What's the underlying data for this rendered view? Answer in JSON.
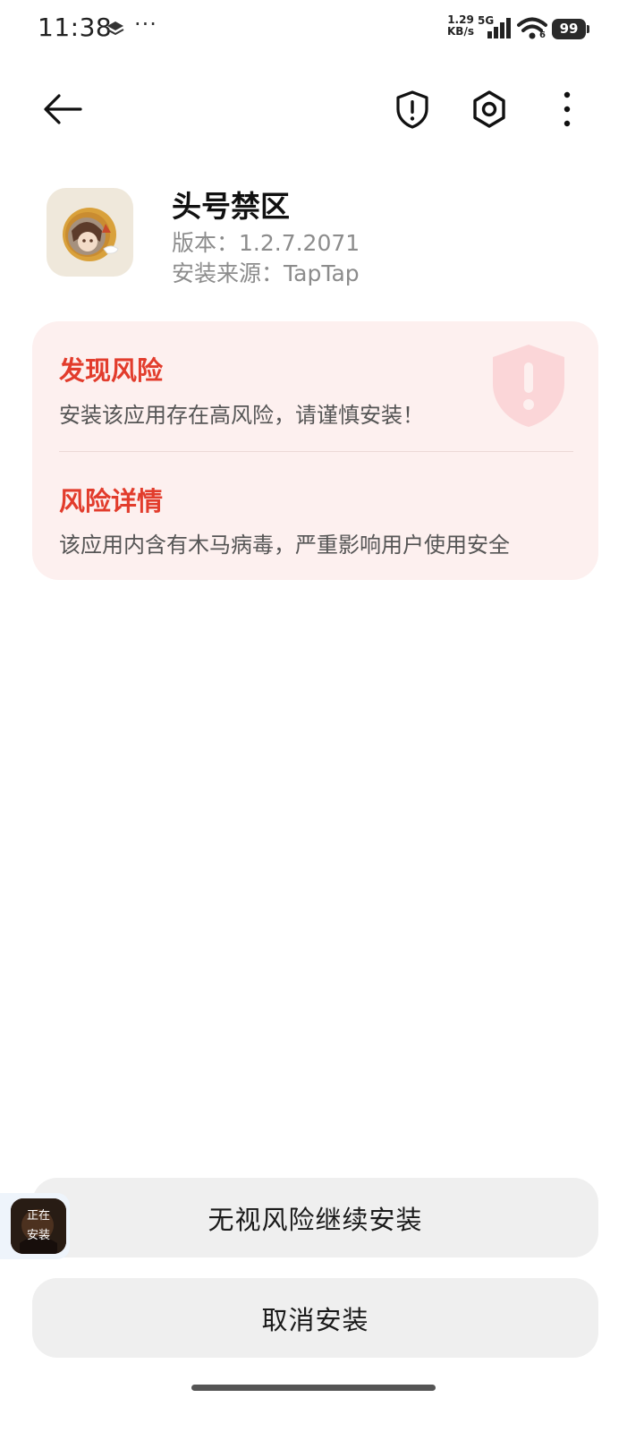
{
  "status_bar": {
    "time": "11:38",
    "more_dots": "···",
    "net_speed_value": "1.29",
    "net_speed_unit": "KB/s",
    "network_type": "5G",
    "wifi_number": "6",
    "battery_level": "99"
  },
  "toolbar": {
    "back_icon": "arrow-left-icon",
    "security_icon": "shield-exclamation-icon",
    "settings_icon": "hexagon-settings-icon",
    "more_icon": "more-vertical-icon"
  },
  "app": {
    "name": "头号禁区",
    "version": "版本：1.2.7.2071",
    "source": "安装来源：TapTap"
  },
  "risk": {
    "title": "发现风险",
    "description": "安装该应用存在高风险，请谨慎安装！",
    "detail_title": "风险详情",
    "detail_description": "该应用内含有木马病毒，严重影响用户使用安全",
    "accent_color": "#e23c2c",
    "card_color": "#fdf0ef"
  },
  "buttons": {
    "continue": "无视风险继续安装",
    "cancel": "取消安装"
  },
  "installing_bubble": {
    "line1": "正在",
    "line2": "安装"
  }
}
